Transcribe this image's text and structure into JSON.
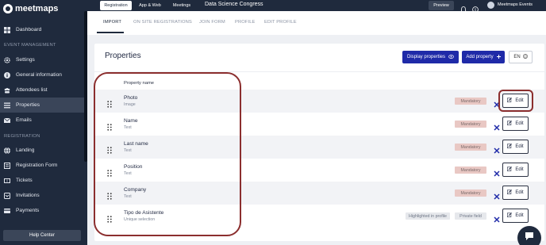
{
  "brand": {
    "name": "meetmaps"
  },
  "topbar": {
    "tabs": [
      {
        "label": "Registration",
        "active": true
      },
      {
        "label": "App & Web",
        "active": false
      },
      {
        "label": "Meetings",
        "active": false
      }
    ],
    "event_title": "Data Science Congress",
    "preview_label": "Preview",
    "user_name": "Meetmaps Events"
  },
  "sidebar": {
    "top_items": [
      {
        "label": "Dashboard",
        "icon": "dashboard-icon"
      }
    ],
    "sections": [
      {
        "title": "EVENT MANAGEMENT",
        "items": [
          {
            "label": "Settings",
            "icon": "gear-icon"
          },
          {
            "label": "General information",
            "icon": "info-icon"
          },
          {
            "label": "Attendees list",
            "icon": "users-icon"
          },
          {
            "label": "Properties",
            "icon": "list-icon",
            "active": true
          },
          {
            "label": "Emails",
            "icon": "mail-icon"
          }
        ]
      },
      {
        "title": "REGISTRATION",
        "items": [
          {
            "label": "Landing",
            "icon": "globe-icon"
          },
          {
            "label": "Registration Form",
            "icon": "form-icon"
          },
          {
            "label": "Tickets",
            "icon": "ticket-icon"
          },
          {
            "label": "Invitations",
            "icon": "invitation-icon"
          },
          {
            "label": "Payments",
            "icon": "card-icon"
          }
        ]
      }
    ],
    "help_label": "Help Center"
  },
  "subtabs": [
    {
      "label": "IMPORT",
      "active": true
    },
    {
      "label": "ON SITE REGISTRATIONS"
    },
    {
      "label": "JOIN FORM"
    },
    {
      "label": "PROFILE"
    },
    {
      "label": "EDIT PROFILE"
    }
  ],
  "properties": {
    "title": "Properties",
    "display_button": "Display properties",
    "add_button": "Add property",
    "language": "EN",
    "column_header": "Property name",
    "edit_label": "Edit",
    "rows": [
      {
        "name": "Photo",
        "type": "Image",
        "tags": [
          "Mandatory"
        ]
      },
      {
        "name": "Name",
        "type": "Text",
        "tags": [
          "Mandatory"
        ]
      },
      {
        "name": "Last name",
        "type": "Text",
        "tags": [
          "Mandatory"
        ]
      },
      {
        "name": "Position",
        "type": "Text",
        "tags": [
          "Mandatory"
        ]
      },
      {
        "name": "Company",
        "type": "Text",
        "tags": [
          "Mandatory"
        ]
      },
      {
        "name": "Tipo de Asistente",
        "type": "Unique selection",
        "tags": [
          "Highlighted in profile",
          "Private field"
        ]
      }
    ]
  },
  "colors": {
    "sidebar": "#1f2a3d",
    "primary": "#1f2aa8",
    "mandatory_tag": "#e9c8c4",
    "highlight": "#8b2e2e"
  }
}
